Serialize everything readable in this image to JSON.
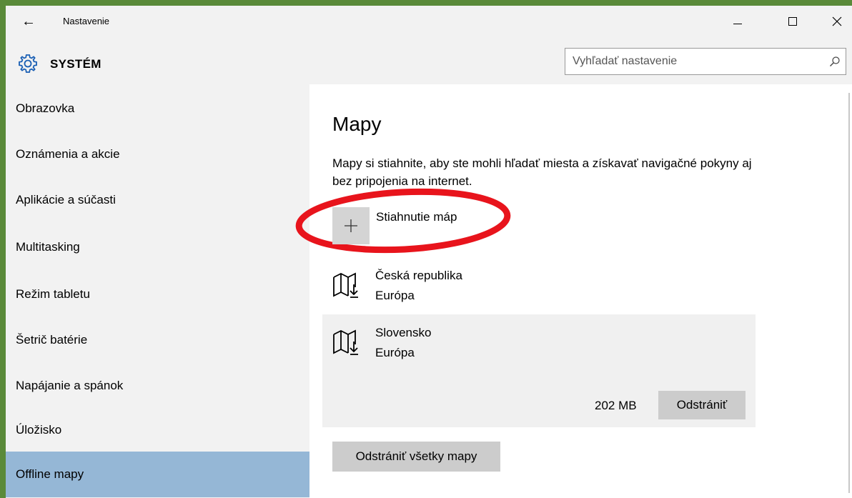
{
  "titlebar": {
    "back_icon": "back-arrow-icon",
    "app_title": "Nastavenie",
    "minimize_icon": "minimize-icon",
    "maximize_icon": "maximize-icon",
    "close_icon": "close-icon"
  },
  "header": {
    "section_icon": "gear-icon",
    "section_title": "SYSTÉM",
    "search_placeholder": "Vyhľadať nastavenie",
    "search_icon": "search-icon"
  },
  "sidebar": {
    "items": [
      {
        "label": "Obrazovka",
        "active": false
      },
      {
        "label": "Oznámenia a akcie",
        "active": false
      },
      {
        "label": "Aplikácie a súčasti",
        "active": false
      },
      {
        "label": "Multitasking",
        "active": false
      },
      {
        "label": "Režim tabletu",
        "active": false
      },
      {
        "label": "Šetrič batérie",
        "active": false
      },
      {
        "label": "Napájanie a spánok",
        "active": false
      },
      {
        "label": "Úložisko",
        "active": false
      },
      {
        "label": "Offline mapy",
        "active": true
      }
    ],
    "active_color": "#95b7d6"
  },
  "main": {
    "title": "Mapy",
    "description": "Mapy si stiahnite, aby ste mohli hľadať miesta a získavať navigačné pokyny aj bez pripojenia na internet.",
    "add_icon": "plus-icon",
    "add_label": "Stiahnutie máp",
    "highlight_color": "#e8141c",
    "maps": [
      {
        "name": "Česká republika",
        "region": "Európa",
        "icon": "map-download-icon"
      },
      {
        "name": "Slovensko",
        "region": "Európa",
        "icon": "map-download-icon",
        "size": "202 MB",
        "remove_label": "Odstrániť"
      }
    ],
    "remove_all_label": "Odstrániť všetky mapy"
  }
}
